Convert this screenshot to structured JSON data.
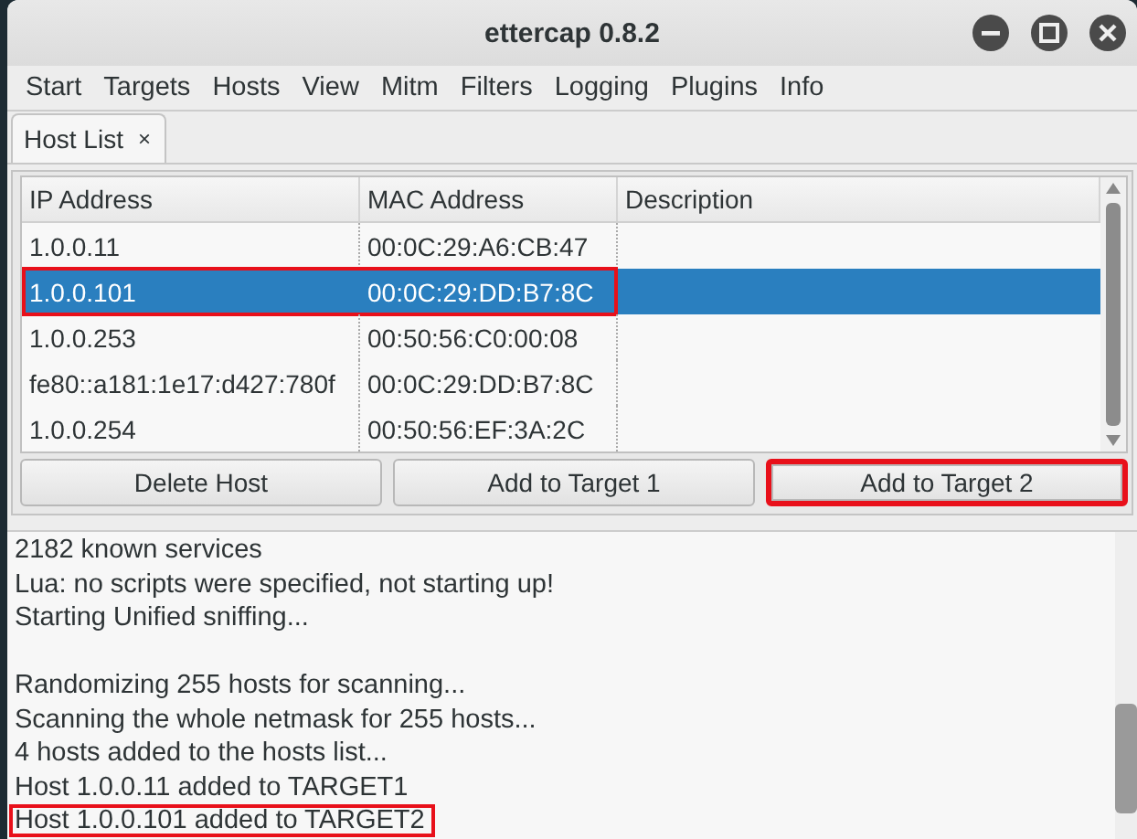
{
  "window": {
    "title": "ettercap 0.8.2"
  },
  "menu": [
    "Start",
    "Targets",
    "Hosts",
    "View",
    "Mitm",
    "Filters",
    "Logging",
    "Plugins",
    "Info"
  ],
  "tabs": [
    {
      "label": "Host List",
      "close": "×",
      "selected": true
    }
  ],
  "table": {
    "columns": [
      "IP Address",
      "MAC Address",
      "Description"
    ],
    "rows": [
      {
        "ip": "1.0.0.11",
        "mac": "00:0C:29:A6:CB:47",
        "selected": false,
        "annotated": false
      },
      {
        "ip": "1.0.0.101",
        "mac": "00:0C:29:DD:B7:8C",
        "selected": true,
        "annotated": true
      },
      {
        "ip": "1.0.0.253",
        "mac": "00:50:56:C0:00:08",
        "selected": false,
        "annotated": false
      },
      {
        "ip": "fe80::a181:1e17:d427:780f",
        "mac": "00:0C:29:DD:B7:8C",
        "selected": false,
        "annotated": false
      },
      {
        "ip": "1.0.0.254",
        "mac": "00:50:56:EF:3A:2C",
        "selected": false,
        "annotated": false
      }
    ]
  },
  "buttons": [
    {
      "label": "Delete Host",
      "annotated": false
    },
    {
      "label": "Add to Target 1",
      "annotated": false
    },
    {
      "label": "Add to Target 2",
      "annotated": true
    }
  ],
  "log": [
    {
      "text": "2182 known services",
      "annotated": false
    },
    {
      "text": "Lua: no scripts were specified, not starting up!",
      "annotated": false
    },
    {
      "text": "Starting Unified sniffing...",
      "annotated": false
    },
    {
      "text": "Randomizing 255 hosts for scanning...",
      "annotated": false,
      "gap_before": true
    },
    {
      "text": "Scanning the whole netmask for 255 hosts...",
      "annotated": false
    },
    {
      "text": "4 hosts added to the hosts list...",
      "annotated": false
    },
    {
      "text": "Host 1.0.0.11 added to TARGET1",
      "annotated": false
    },
    {
      "text": "Host 1.0.0.101 added to TARGET2",
      "annotated": true
    }
  ]
}
